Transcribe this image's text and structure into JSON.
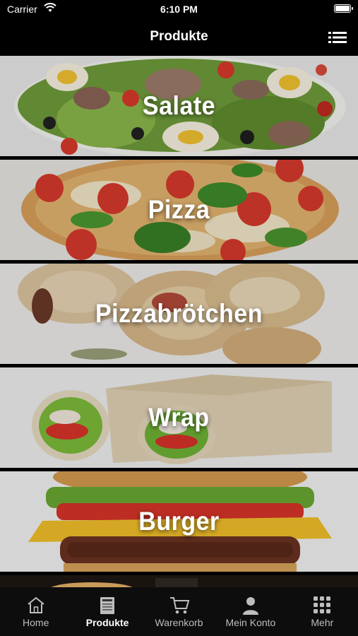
{
  "status_bar": {
    "carrier": "Carrier",
    "time": "6:10 PM"
  },
  "header": {
    "title": "Produkte",
    "menu_icon": "list-icon"
  },
  "categories": [
    {
      "label": "Salate",
      "image": "salad-photo"
    },
    {
      "label": "Pizza",
      "image": "pizza-photo"
    },
    {
      "label": "Pizzabrötchen",
      "image": "pizza-rolls-photo"
    },
    {
      "label": "Wrap",
      "image": "wrap-photo"
    },
    {
      "label": "Burger",
      "image": "burger-photo"
    }
  ],
  "tabs": [
    {
      "label": "Home",
      "icon": "home-icon",
      "active": false
    },
    {
      "label": "Produkte",
      "icon": "menu-card-icon",
      "active": true
    },
    {
      "label": "Warenkorb",
      "icon": "cart-icon",
      "active": false
    },
    {
      "label": "Mein Konto",
      "icon": "user-icon",
      "active": false
    },
    {
      "label": "Mehr",
      "icon": "grid-icon",
      "active": false
    }
  ]
}
